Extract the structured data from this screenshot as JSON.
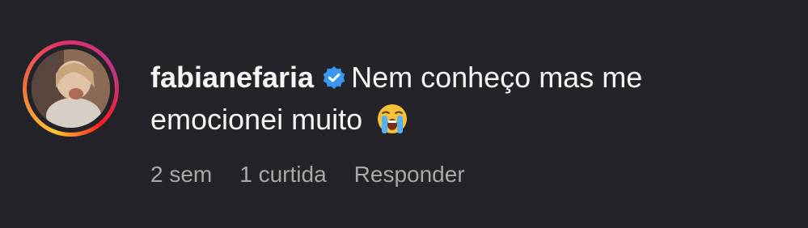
{
  "comment": {
    "username": "fabianefaria",
    "verified": true,
    "text_line1": "Nem conheço mas me",
    "text_line2": "emocionei muito",
    "emoji": "loudly-crying-face",
    "time": "2 sem",
    "likes": "1 curtida",
    "reply_label": "Responder"
  },
  "colors": {
    "background": "#232329",
    "text": "#f5f5f5",
    "meta": "#a8a8a8",
    "verified_badge": "#3897f0"
  }
}
